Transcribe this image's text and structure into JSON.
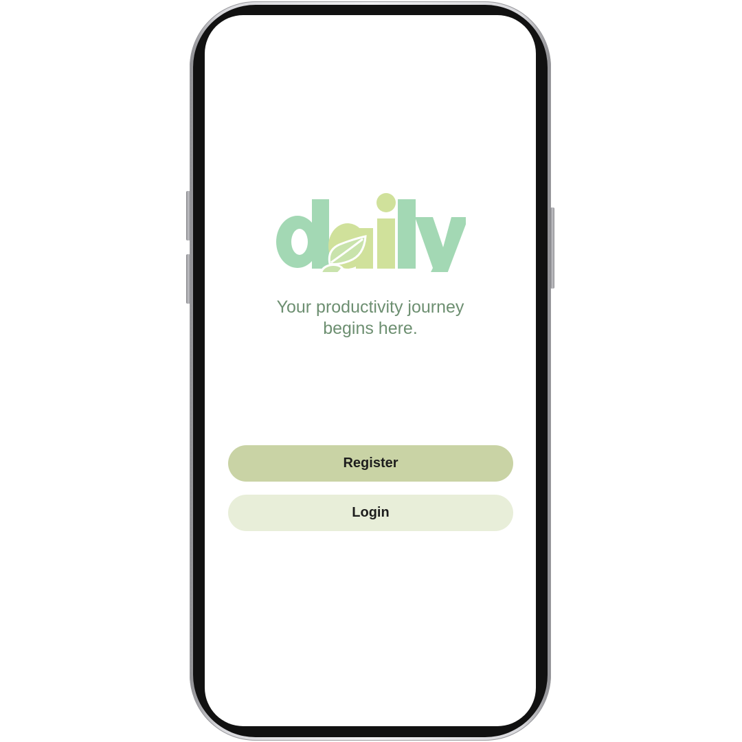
{
  "app": {
    "logo_text": "daily",
    "tagline_line1": "Your productivity journey",
    "tagline_line2": "begins here."
  },
  "buttons": {
    "register_label": "Register",
    "login_label": "Login"
  },
  "colors": {
    "logo_green": "#a3d8b4",
    "logo_lime": "#d0e19b",
    "tagline": "#6d8f71",
    "register_bg": "#c9d3a5",
    "login_bg": "#e8eed9"
  },
  "icons": {
    "leaf": "leaf-icon"
  }
}
